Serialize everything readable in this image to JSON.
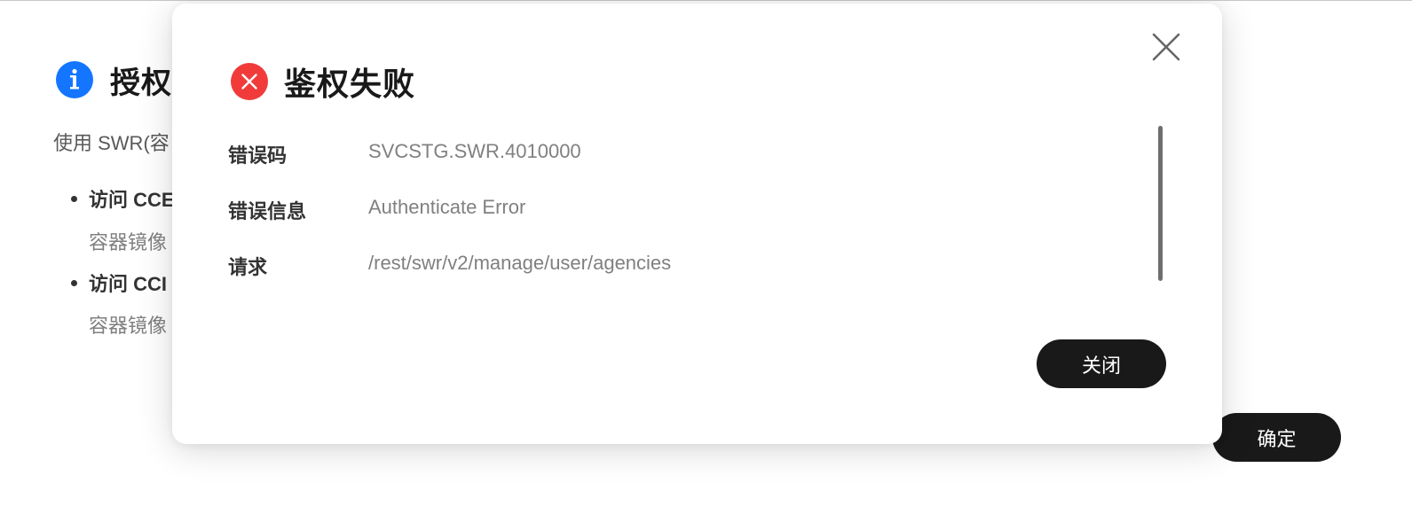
{
  "background_dialog": {
    "title": "授权",
    "description": "使用 SWR(容",
    "bullets": [
      {
        "label": "访问 CCE",
        "sub": "容器镜像"
      },
      {
        "label": "访问 CCI",
        "sub": "容器镜像"
      }
    ],
    "ok_label": "确定"
  },
  "modal": {
    "title": "鉴权失败",
    "fields": [
      {
        "label": "错误码",
        "value": "SVCSTG.SWR.4010000"
      },
      {
        "label": "错误信息",
        "value": "Authenticate Error"
      },
      {
        "label": "请求",
        "value": "/rest/swr/v2/manage/user/agencies"
      }
    ],
    "close_button_label": "关闭"
  },
  "icons": {
    "info": "info-icon",
    "error": "error-circle-icon",
    "close": "close-icon"
  },
  "colors": {
    "info_blue": "#1476ff",
    "error_red": "#f13b3b",
    "button_dark": "#191919"
  }
}
